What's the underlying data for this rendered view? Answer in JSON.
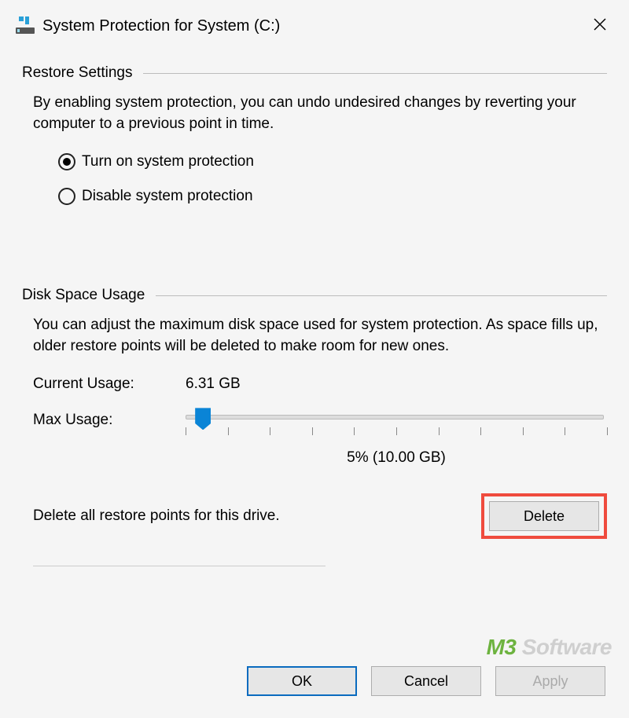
{
  "title_bar": {
    "title": "System Protection for System (C:)"
  },
  "restore": {
    "section_label": "Restore Settings",
    "desc": "By enabling system protection, you can undo undesired changes by reverting your computer to a previous point in time.",
    "option_on": "Turn on system protection",
    "option_off": "Disable system protection",
    "selected": "on"
  },
  "disk": {
    "section_label": "Disk Space Usage",
    "desc": "You can adjust the maximum disk space used for system protection. As space fills up, older restore points will be deleted to make room for new ones.",
    "current_label": "Current Usage:",
    "current_value": "6.31 GB",
    "max_label": "Max Usage:",
    "slider_value_text": "5% (10.00 GB)",
    "delete_text": "Delete all restore points for this drive.",
    "delete_button": "Delete"
  },
  "buttons": {
    "ok": "OK",
    "cancel": "Cancel",
    "apply": "Apply"
  },
  "watermark": {
    "brand_prefix": "M3",
    "brand_suffix": " Software"
  }
}
